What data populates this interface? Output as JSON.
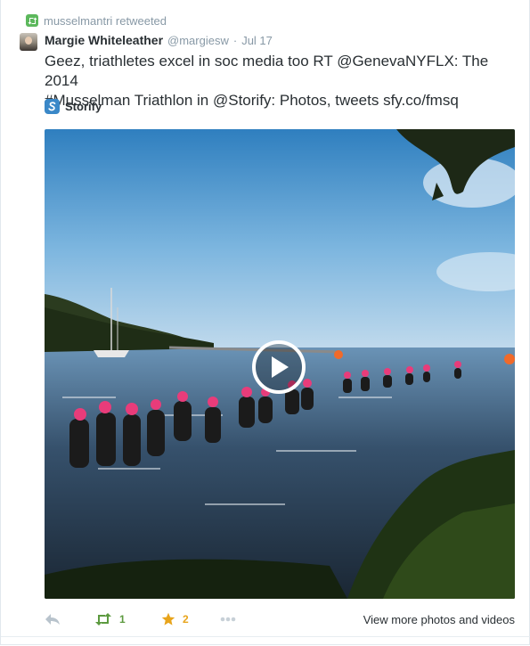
{
  "retweet_context": {
    "user": "musselmantri",
    "verb": "retweeted",
    "icon": "retweet-icon",
    "color": "#5cb85c"
  },
  "tweet": {
    "author_name": "Margie Whiteleather",
    "author_handle": "@margiesw",
    "separator": "·",
    "timestamp": "Jul 17",
    "text_line1": "Geez, triathletes excel in soc media too RT @GenevaNYFLX: The 2014",
    "text_line2": "#Musselman Triathlon in @Storify: Photos, tweets sfy.co/fmsq"
  },
  "card": {
    "source_label": "Storify",
    "source_icon": "storify-logo-icon",
    "media_icon": "play-icon",
    "view_more_label": "View more photos and videos"
  },
  "actions": {
    "reply_icon": "reply-icon",
    "retweet_icon": "retweet-icon",
    "retweet_count": "1",
    "favorite_icon": "star-icon",
    "favorite_count": "2",
    "more_icon": "more-dots-icon",
    "retweet_color": "#5c9a3f",
    "favorite_color": "#e8a41b"
  }
}
